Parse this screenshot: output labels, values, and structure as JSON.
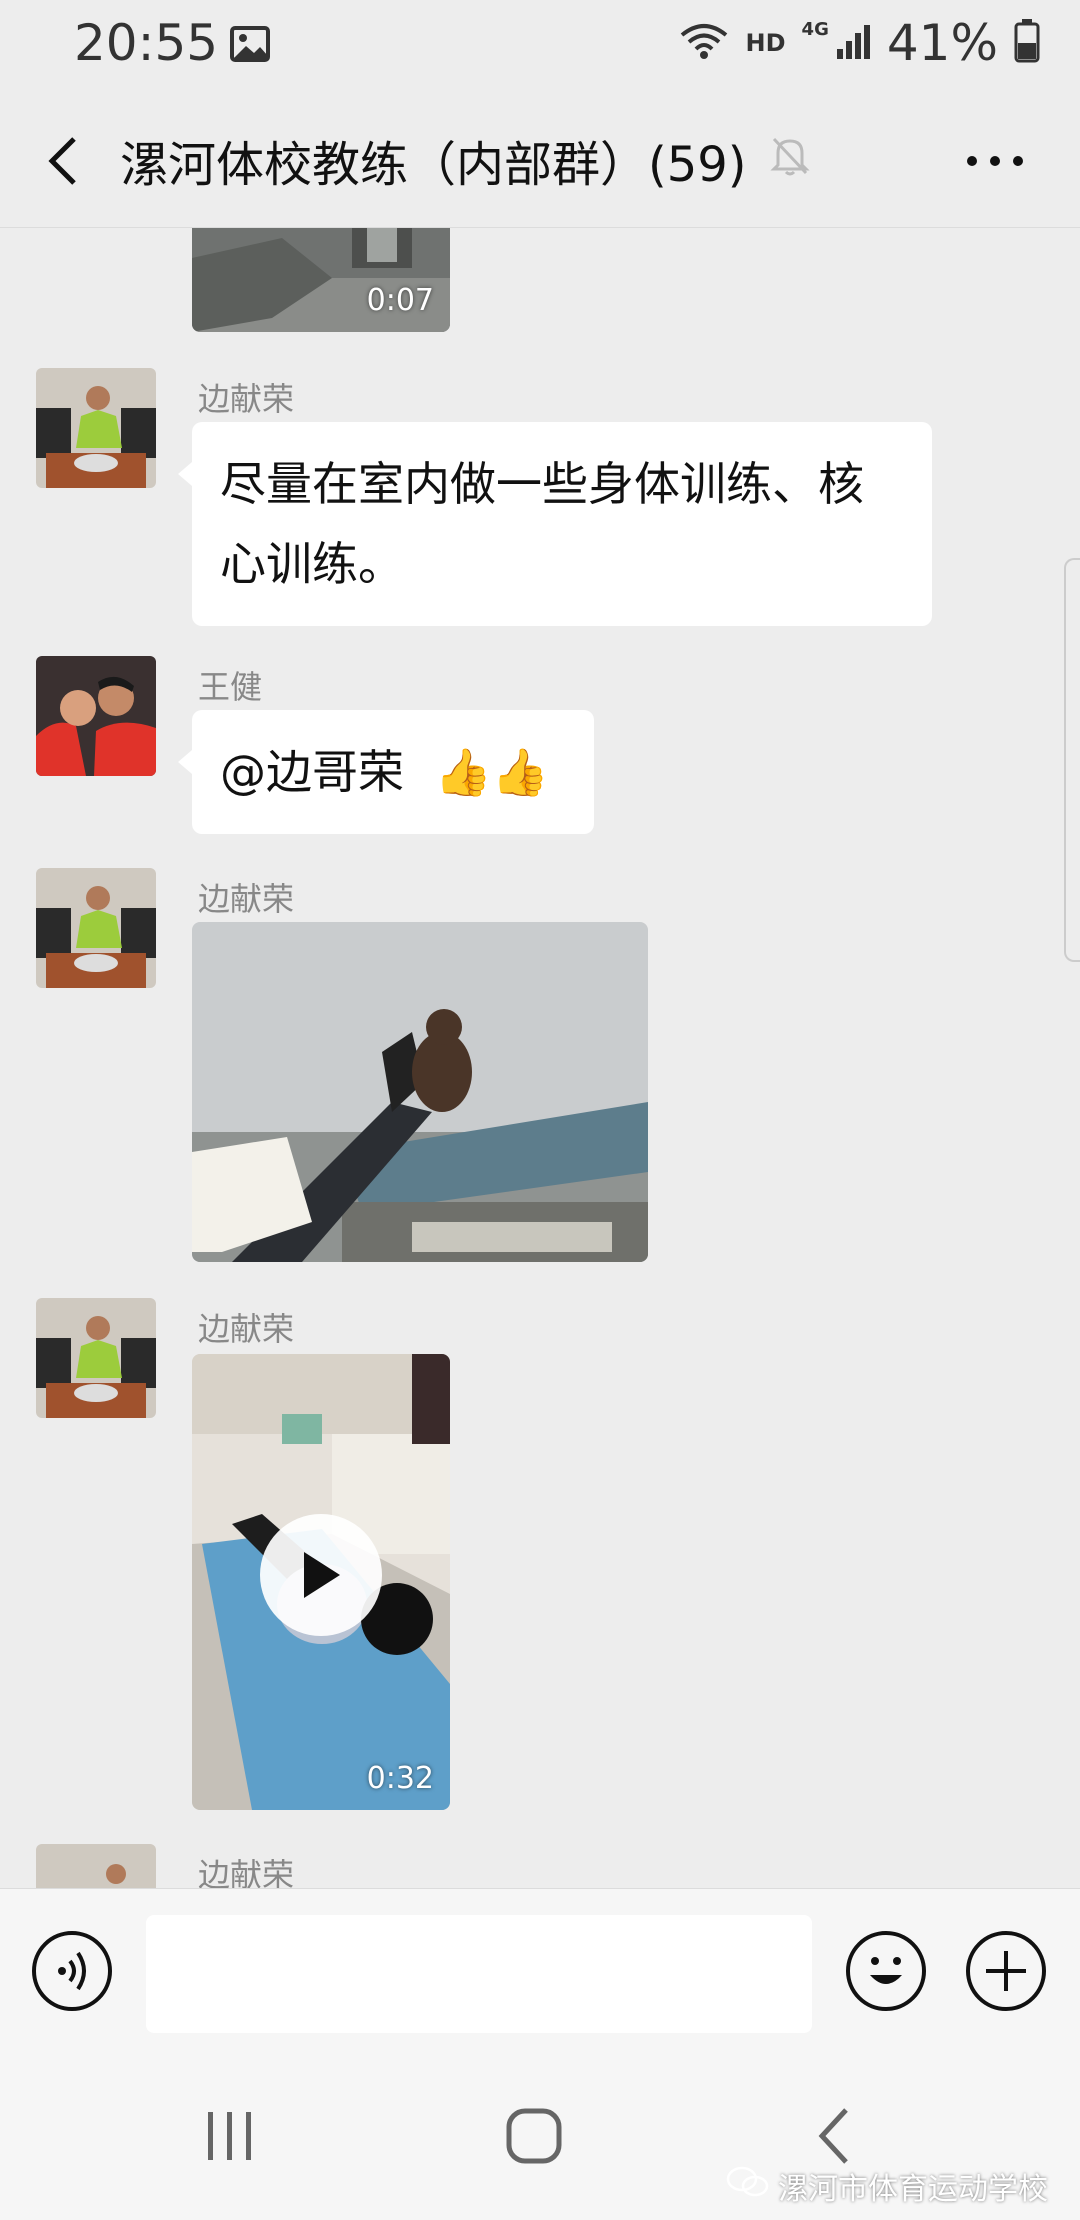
{
  "status_bar": {
    "time": "20:55",
    "network_hd": "HD",
    "network_type": "4G",
    "battery": "41%"
  },
  "header": {
    "title": "漯河体校教练（内部群）(59)"
  },
  "messages": [
    {
      "type": "video",
      "duration": "0:07"
    },
    {
      "type": "text",
      "sender": "边献荣",
      "text": "尽量在室内做一些身体训练、核心训练。"
    },
    {
      "type": "text",
      "sender": "王健",
      "text": "@边哥荣",
      "emoji": "👍👍"
    },
    {
      "type": "image",
      "sender": "边献荣"
    },
    {
      "type": "video",
      "sender": "边献荣",
      "duration": "0:32"
    },
    {
      "type": "partial",
      "sender": "边献荣"
    }
  ],
  "input": {
    "value": ""
  },
  "watermark": "漯河市体育运动学校",
  "colors": {
    "background": "#ededed",
    "bubble": "#ffffff",
    "sender_name": "#888888"
  }
}
